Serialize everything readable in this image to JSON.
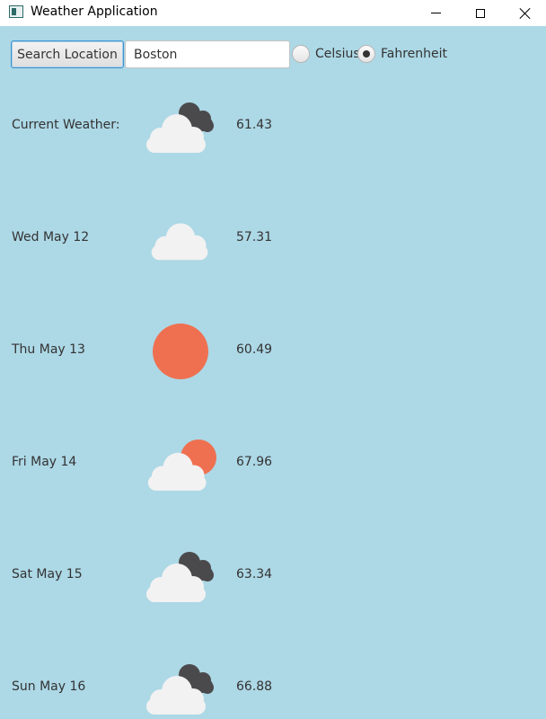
{
  "window": {
    "title": "Weather Application"
  },
  "toolbar": {
    "search_button": "Search Location",
    "location_value": "Boston",
    "unit_options": [
      "Celsius",
      "Fahrenheit"
    ],
    "selected_unit": "Fahrenheit"
  },
  "current": {
    "label": "Current Weather:",
    "icon": "partly-cloudy-dark-icon",
    "temp": "61.43"
  },
  "forecast": [
    {
      "day": "Wed May 12",
      "icon": "cloud-icon",
      "temp": "57.31"
    },
    {
      "day": "Thu May 13",
      "icon": "sun-icon",
      "temp": "60.49"
    },
    {
      "day": "Fri May 14",
      "icon": "sun-behind-cloud-icon",
      "temp": "67.96"
    },
    {
      "day": "Sat May 15",
      "icon": "partly-cloudy-dark-icon",
      "temp": "63.34"
    },
    {
      "day": "Sun May 16",
      "icon": "partly-cloudy-dark-icon",
      "temp": "66.88"
    }
  ],
  "colors": {
    "background": "#ADD8E6",
    "cloud_light": "#F2F2F2",
    "cloud_dark": "#4A4A4C",
    "sun": "#EF7050"
  }
}
